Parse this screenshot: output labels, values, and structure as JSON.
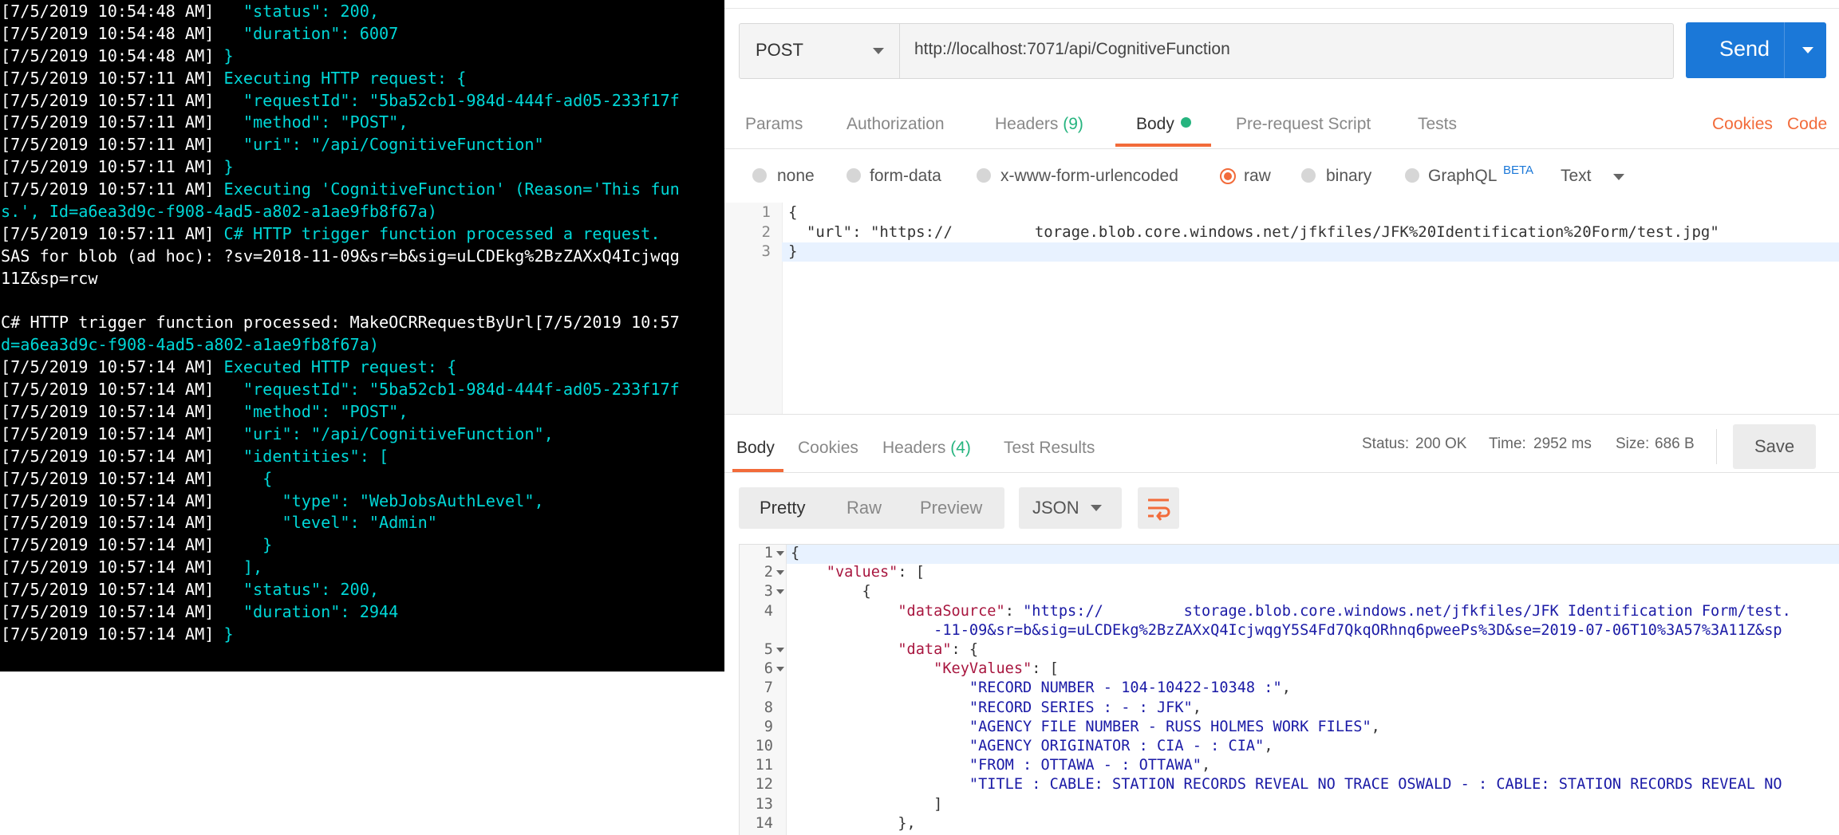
{
  "terminal": {
    "lines": [
      {
        "ts": "[7/5/2019 10:54:48 AM]",
        "text": "   \"status\": 200,",
        "cls": "tt"
      },
      {
        "ts": "[7/5/2019 10:54:48 AM]",
        "text": "   \"duration\": 6007",
        "cls": "tt"
      },
      {
        "ts": "[7/5/2019 10:54:48 AM]",
        "text": " }",
        "cls": "tt"
      },
      {
        "ts": "[7/5/2019 10:57:11 AM]",
        "text": " Executing HTTP request: {",
        "cls": "tt"
      },
      {
        "ts": "[7/5/2019 10:57:11 AM]",
        "text": "   \"requestId\": \"5ba52cb1-984d-444f-ad05-233f17f",
        "cls": "tt"
      },
      {
        "ts": "[7/5/2019 10:57:11 AM]",
        "text": "   \"method\": \"POST\",",
        "cls": "tt"
      },
      {
        "ts": "[7/5/2019 10:57:11 AM]",
        "text": "   \"uri\": \"/api/CognitiveFunction\"",
        "cls": "tt"
      },
      {
        "ts": "[7/5/2019 10:57:11 AM]",
        "text": " }",
        "cls": "tt"
      },
      {
        "ts": "[7/5/2019 10:57:11 AM]",
        "text": " Executing 'CognitiveFunction' (Reason='This fun",
        "cls": "tt"
      },
      {
        "ts": "",
        "text": "s.', Id=a6ea3d9c-f908-4ad5-a802-a1ae9fb8f67a)",
        "cls": "tt"
      },
      {
        "ts": "[7/5/2019 10:57:11 AM]",
        "text": " C# HTTP trigger function processed a request.",
        "cls": "tt"
      },
      {
        "ts": "",
        "text": "SAS for blob (ad hoc): ?sv=2018-11-09&sr=b&sig=uLCDEkg%2BzZAXxQ4Icjwqg",
        "cls": "w"
      },
      {
        "ts": "",
        "text": "11Z&sp=rcw",
        "cls": "w"
      },
      {
        "ts": "",
        "text": "",
        "cls": "w"
      },
      {
        "ts": "",
        "text": "C# HTTP trigger function processed: MakeOCRRequestByUrl[7/5/2019 10:57",
        "cls": "w"
      },
      {
        "ts": "",
        "text": "d=a6ea3d9c-f908-4ad5-a802-a1ae9fb8f67a)",
        "cls": "tt"
      },
      {
        "ts": "[7/5/2019 10:57:14 AM]",
        "text": " Executed HTTP request: {",
        "cls": "tt"
      },
      {
        "ts": "[7/5/2019 10:57:14 AM]",
        "text": "   \"requestId\": \"5ba52cb1-984d-444f-ad05-233f17f",
        "cls": "tt"
      },
      {
        "ts": "[7/5/2019 10:57:14 AM]",
        "text": "   \"method\": \"POST\",",
        "cls": "tt"
      },
      {
        "ts": "[7/5/2019 10:57:14 AM]",
        "text": "   \"uri\": \"/api/CognitiveFunction\",",
        "cls": "tt"
      },
      {
        "ts": "[7/5/2019 10:57:14 AM]",
        "text": "   \"identities\": [",
        "cls": "tt"
      },
      {
        "ts": "[7/5/2019 10:57:14 AM]",
        "text": "     {",
        "cls": "tt"
      },
      {
        "ts": "[7/5/2019 10:57:14 AM]",
        "text": "       \"type\": \"WebJobsAuthLevel\",",
        "cls": "tt"
      },
      {
        "ts": "[7/5/2019 10:57:14 AM]",
        "text": "       \"level\": \"Admin\"",
        "cls": "tt"
      },
      {
        "ts": "[7/5/2019 10:57:14 AM]",
        "text": "     }",
        "cls": "tt"
      },
      {
        "ts": "[7/5/2019 10:57:14 AM]",
        "text": "   ],",
        "cls": "tt"
      },
      {
        "ts": "[7/5/2019 10:57:14 AM]",
        "text": "   \"status\": 200,",
        "cls": "tt"
      },
      {
        "ts": "[7/5/2019 10:57:14 AM]",
        "text": "   \"duration\": 2944",
        "cls": "tt"
      },
      {
        "ts": "[7/5/2019 10:57:14 AM]",
        "text": " }",
        "cls": "tt"
      }
    ]
  },
  "request": {
    "method": "POST",
    "url": "http://localhost:7071/api/CognitiveFunction",
    "send_label": "Send"
  },
  "request_tabs": {
    "params": "Params",
    "authorization": "Authorization",
    "headers": "Headers",
    "headers_count": "(9)",
    "body": "Body",
    "prerequest": "Pre-request Script",
    "tests": "Tests",
    "cookies": "Cookies",
    "code": "Code"
  },
  "body_options": {
    "none": "none",
    "form_data": "form-data",
    "urlencoded": "x-www-form-urlencoded",
    "raw": "raw",
    "binary": "binary",
    "graphql": "GraphQL",
    "beta": "BETA",
    "text_type": "Text",
    "selected": "raw"
  },
  "request_body": {
    "lines": [
      {
        "n": "1",
        "text": "{"
      },
      {
        "n": "2",
        "text": "  \"url\": \"https://         torage.blob.core.windows.net/jfkfiles/JFK%20Identification%20Form/test.jpg\""
      },
      {
        "n": "3",
        "text": "}"
      }
    ]
  },
  "response_tabs": {
    "body": "Body",
    "cookies": "Cookies",
    "headers": "Headers",
    "headers_count": "(4)",
    "test_results": "Test Results"
  },
  "response_status": {
    "status_label": "Status:",
    "status_value": "200 OK",
    "time_label": "Time:",
    "time_value": "2952 ms",
    "size_label": "Size:",
    "size_value": "686 B",
    "save_label": "Save"
  },
  "response_format": {
    "pretty": "Pretty",
    "raw": "Raw",
    "preview": "Preview",
    "json": "JSON"
  },
  "response_body": {
    "lines": [
      {
        "n": "1",
        "fold": true,
        "html": "{"
      },
      {
        "n": "2",
        "fold": true,
        "html": "    <span class=\"k\">\"values\"</span>: ["
      },
      {
        "n": "3",
        "fold": true,
        "html": "        {"
      },
      {
        "n": "4",
        "fold": false,
        "html": "            <span class=\"k\">\"dataSource\"</span>: <span class=\"s\">\"https://         storage.blob.core.windows.net/jfkfiles/JFK Identification Form/test.</span>"
      },
      {
        "n": "",
        "fold": false,
        "html": "                <span class=\"s\">-11-09&amp;sr=b&amp;sig=uLCDEkg%2BzZAXxQ4IcjwqgY5S4Fd7QkqORhnq6pweePs%3D&amp;se=2019-07-06T10%3A57%3A11Z&amp;sp</span>"
      },
      {
        "n": "5",
        "fold": true,
        "html": "            <span class=\"k\">\"data\"</span>: {"
      },
      {
        "n": "6",
        "fold": true,
        "html": "                <span class=\"k\">\"KeyValues\"</span>: ["
      },
      {
        "n": "7",
        "fold": false,
        "html": "                    <span class=\"s\">\"RECORD NUMBER - 104-10422-10348 :\"</span>,"
      },
      {
        "n": "8",
        "fold": false,
        "html": "                    <span class=\"s\">\"RECORD SERIES : - : JFK\"</span>,"
      },
      {
        "n": "9",
        "fold": false,
        "html": "                    <span class=\"s\">\"AGENCY FILE NUMBER - RUSS HOLMES WORK FILES\"</span>,"
      },
      {
        "n": "10",
        "fold": false,
        "html": "                    <span class=\"s\">\"AGENCY ORIGINATOR : CIA - : CIA\"</span>,"
      },
      {
        "n": "11",
        "fold": false,
        "html": "                    <span class=\"s\">\"FROM : OTTAWA - : OTTAWA\"</span>,"
      },
      {
        "n": "12",
        "fold": false,
        "html": "                    <span class=\"s\">\"TITLE : CABLE: STATION RECORDS REVEAL NO TRACE OSWALD - : CABLE: STATION RECORDS REVEAL NO</span>"
      },
      {
        "n": "13",
        "fold": false,
        "html": "                ]"
      },
      {
        "n": "14",
        "fold": false,
        "html": "            },"
      }
    ]
  },
  "colors": {
    "accent": "#f26b3a",
    "send": "#1b78d8",
    "ok": "#26b47f",
    "terminal_text": "#00d7d7"
  }
}
